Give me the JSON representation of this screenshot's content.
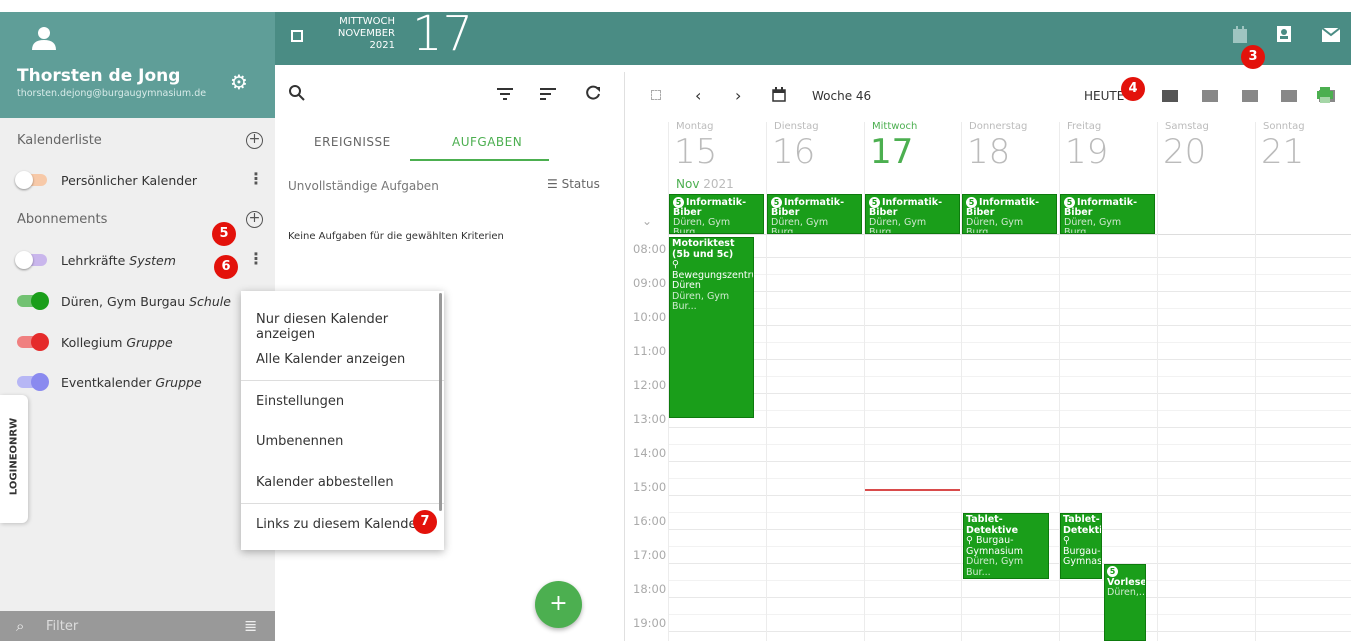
{
  "user": {
    "name": "Thorsten de Jong",
    "email": "thorsten.dejong@burgaugymnasium.de"
  },
  "header": {
    "weekday": "MITTWOCH",
    "month": "NOVEMBER",
    "year": "2021",
    "day": "17"
  },
  "sidebar": {
    "calendar_list_title": "Kalenderliste",
    "personal_calendar": "Persönlicher Kalender",
    "subscriptions_title": "Abonnements",
    "subscriptions": [
      {
        "label": "Lehrkräfte",
        "tag": "System",
        "color": "#b9a2e0"
      },
      {
        "label": "Düren, Gym Burgau",
        "tag": "Schule",
        "color": "#1a9e1a"
      },
      {
        "label": "Kollegium",
        "tag": "Gruppe",
        "color": "#e52b2b"
      },
      {
        "label": "Eventkalender",
        "tag": "Gruppe",
        "color": "#8a8aef"
      }
    ],
    "filter_placeholder": "Filter",
    "vertical_logo": "LOGINEONRW"
  },
  "tasks": {
    "tabs": [
      "EREIGNISSE",
      "AUFGABEN"
    ],
    "incomplete_label": "Unvollständige Aufgaben",
    "status_label": "Status",
    "empty_text": "Keine Aufgaben für die gewählten Kriterien",
    "fab": "+"
  },
  "context_menu": {
    "items": [
      "Nur diesen Kalender anzeigen",
      "Alle Kalender anzeigen",
      "Einstellungen",
      "Umbenennen",
      "Kalender abbestellen",
      "Links zu diesem Kalender"
    ]
  },
  "badges": [
    "3",
    "4",
    "5",
    "6",
    "7"
  ],
  "calendar": {
    "week_label": "Woche 46",
    "today_label": "HEUTE",
    "month_label": "Nov",
    "month_year": "2021",
    "days": [
      {
        "name": "Montag",
        "num": "15"
      },
      {
        "name": "Dienstag",
        "num": "16"
      },
      {
        "name": "Mittwoch",
        "num": "17"
      },
      {
        "name": "Donnerstag",
        "num": "18"
      },
      {
        "name": "Freitag",
        "num": "19"
      },
      {
        "name": "Samstag",
        "num": "20"
      },
      {
        "name": "Sonntag",
        "num": "21"
      }
    ],
    "hours": [
      "08:00",
      "09:00",
      "10:00",
      "11:00",
      "12:00",
      "13:00",
      "14:00",
      "15:00",
      "16:00",
      "17:00",
      "18:00",
      "19:00"
    ],
    "allday_event": {
      "count": "5",
      "title": "Informatik-Biber",
      "location": "Düren, Gym Burg..."
    },
    "events": {
      "mon": {
        "title": "Motoriktest (5b und 5c)",
        "loc": "Bewegungszentrum Düren",
        "cal": "Düren, Gym Bur..."
      },
      "thu": {
        "title": "Tablet-Detektive",
        "loc": "Burgau-Gymnasium",
        "cal": "Düren, Gym Bur..."
      },
      "fri": {
        "title": "Tablet-Detektive",
        "loc": "Burgau-Gymnasium"
      },
      "fri2": {
        "count": "5",
        "title": "Vorleset",
        "cal": "Düren,..."
      }
    }
  }
}
